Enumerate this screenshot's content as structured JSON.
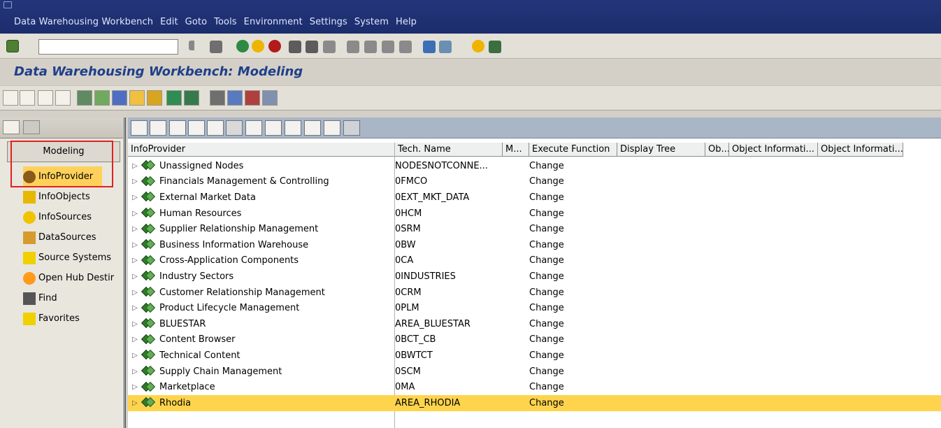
{
  "menubar": {
    "items": [
      "Data Warehousing Workbench",
      "Edit",
      "Goto",
      "Tools",
      "Environment",
      "Settings",
      "System",
      "Help"
    ]
  },
  "toolbar": {
    "command_field_value": "",
    "icons": [
      "enter-icon",
      "command-field-dropdown-icon",
      "back-icon",
      "save-icon",
      "exit-icon",
      "cancel-icon",
      "print-icon",
      "find-icon",
      "find-next-icon",
      "first-page-icon",
      "previous-page-icon",
      "next-page-icon",
      "last-page-icon",
      "create-session-icon",
      "shortcut-icon",
      "help-icon",
      "layout-icon"
    ]
  },
  "page": {
    "title": "Data Warehousing Workbench: Modeling"
  },
  "leftpanel": {
    "header_label": "Modeling",
    "items": [
      {
        "label": "InfoProvider",
        "icon": "infoprovider-icon",
        "selected": true
      },
      {
        "label": "InfoObjects",
        "icon": "infoobjects-icon",
        "selected": false
      },
      {
        "label": "InfoSources",
        "icon": "infosources-icon",
        "selected": false
      },
      {
        "label": "DataSources",
        "icon": "datasources-icon",
        "selected": false
      },
      {
        "label": "Source Systems",
        "icon": "source-systems-icon",
        "selected": false
      },
      {
        "label": "Open Hub Destir",
        "icon": "open-hub-icon",
        "selected": false
      },
      {
        "label": "Find",
        "icon": "find-icon",
        "selected": false
      },
      {
        "label": "Favorites",
        "icon": "favorites-icon",
        "selected": false
      }
    ]
  },
  "table": {
    "columns": [
      "InfoProvider",
      "Tech. Name",
      "M...",
      "Execute Function",
      "Display Tree",
      "Ob...",
      "Object Informati...",
      "Object Informati..."
    ],
    "rows": [
      {
        "name": "Unassigned Nodes",
        "tech": "NODESNOTCONNE...",
        "exec": "Change"
      },
      {
        "name": "Financials Management & Controlling",
        "tech": "0FMCO",
        "exec": "Change"
      },
      {
        "name": "External Market Data",
        "tech": "0EXT_MKT_DATA",
        "exec": "Change"
      },
      {
        "name": "Human Resources",
        "tech": "0HCM",
        "exec": "Change"
      },
      {
        "name": "Supplier Relationship Management",
        "tech": "0SRM",
        "exec": "Change"
      },
      {
        "name": "Business Information Warehouse",
        "tech": "0BW",
        "exec": "Change"
      },
      {
        "name": "Cross-Application Components",
        "tech": "0CA",
        "exec": "Change"
      },
      {
        "name": "Industry Sectors",
        "tech": "0INDUSTRIES",
        "exec": "Change"
      },
      {
        "name": "Customer Relationship Management",
        "tech": "0CRM",
        "exec": "Change"
      },
      {
        "name": "Product Lifecycle Management",
        "tech": "0PLM",
        "exec": "Change"
      },
      {
        "name": "BLUESTAR",
        "tech": "AREA_BLUESTAR",
        "exec": "Change"
      },
      {
        "name": "Content Browser",
        "tech": "0BCT_CB",
        "exec": "Change"
      },
      {
        "name": "Technical Content",
        "tech": "0BWTCT",
        "exec": "Change"
      },
      {
        "name": "Supply Chain Management",
        "tech": "0SCM",
        "exec": "Change"
      },
      {
        "name": "Marketplace",
        "tech": "0MA",
        "exec": "Change"
      },
      {
        "name": "Rhodia",
        "tech": "AREA_RHODIA",
        "exec": "Change",
        "selected": true
      }
    ]
  },
  "colors": {
    "menubar_bg": "#1b2d6c",
    "selected_yellow": "#ffd44d",
    "title_blue": "#1f3f8a",
    "highlight_red": "#e32020"
  }
}
